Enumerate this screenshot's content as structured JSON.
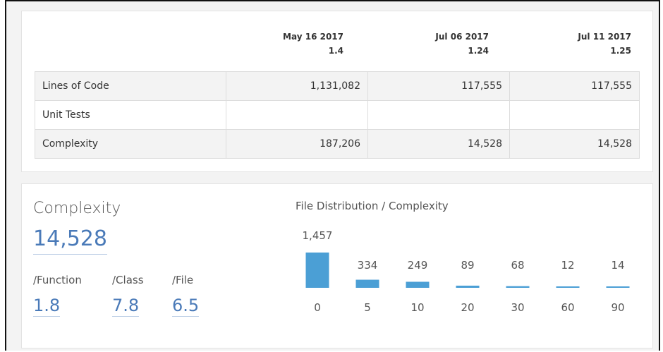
{
  "history": {
    "columns": [
      {
        "date": "May 16 2017",
        "version": "1.4"
      },
      {
        "date": "Jul 06 2017",
        "version": "1.24"
      },
      {
        "date": "Jul 11 2017",
        "version": "1.25"
      }
    ],
    "rows": [
      {
        "label": "Lines of Code",
        "values": [
          "1,131,082",
          "117,555",
          "117,555"
        ]
      },
      {
        "label": "Unit Tests",
        "values": [
          "",
          "",
          ""
        ]
      },
      {
        "label": "Complexity",
        "values": [
          "187,206",
          "14,528",
          "14,528"
        ]
      }
    ]
  },
  "complexity": {
    "title": "Complexity",
    "value": "14,528",
    "function_label": "/Function",
    "function_value": "1.8",
    "class_label": "/Class",
    "class_value": "7.8",
    "file_label": "/File",
    "file_value": "6.5"
  },
  "distribution": {
    "title": "File Distribution / Complexity",
    "bar_color": "#4b9fd5"
  },
  "chart_data": {
    "type": "bar",
    "title": "File Distribution / Complexity",
    "categories": [
      "0",
      "5",
      "10",
      "20",
      "30",
      "60",
      "90"
    ],
    "values": [
      1457,
      334,
      249,
      89,
      68,
      12,
      14
    ],
    "value_labels": [
      "1,457",
      "334",
      "249",
      "89",
      "68",
      "12",
      "14"
    ],
    "xlabel": "",
    "ylabel": ""
  }
}
